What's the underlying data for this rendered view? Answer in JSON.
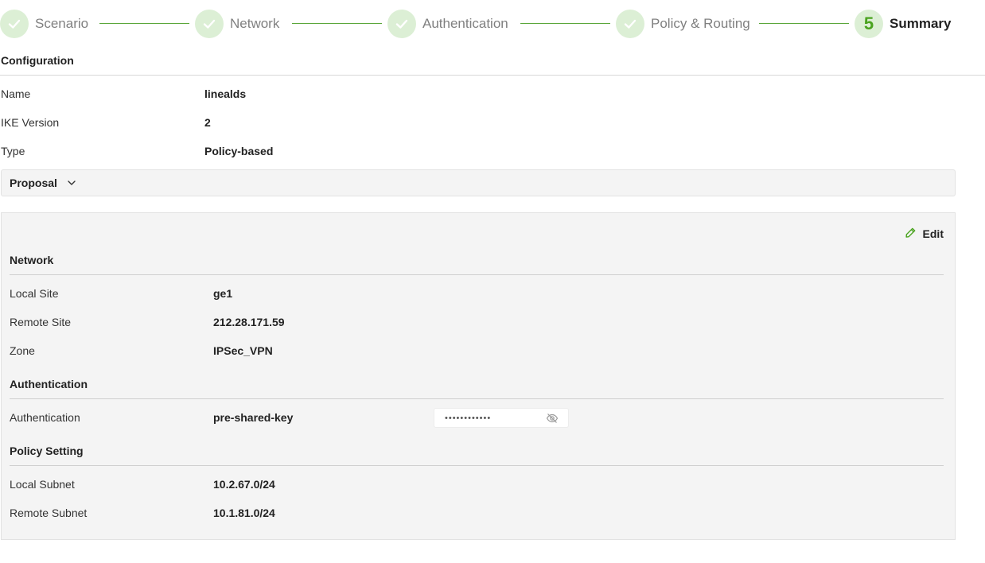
{
  "stepper": {
    "steps": [
      {
        "label": "Scenario",
        "state": "done"
      },
      {
        "label": "Network",
        "state": "done"
      },
      {
        "label": "Authentication",
        "state": "done"
      },
      {
        "label": "Policy & Routing",
        "state": "done"
      },
      {
        "label": "Summary",
        "state": "active",
        "number": "5"
      }
    ]
  },
  "configuration": {
    "title": "Configuration",
    "rows": [
      {
        "label": "Name",
        "value": "linealds"
      },
      {
        "label": "IKE Version",
        "value": "2"
      },
      {
        "label": "Type",
        "value": "Policy-based"
      }
    ],
    "proposal_label": "Proposal"
  },
  "panel": {
    "edit_label": "Edit",
    "network": {
      "title": "Network",
      "rows": [
        {
          "label": "Local Site",
          "value": "ge1"
        },
        {
          "label": "Remote Site",
          "value": "212.28.171.59"
        },
        {
          "label": "Zone",
          "value": "IPSec_VPN"
        }
      ]
    },
    "authentication": {
      "title": "Authentication",
      "rows": [
        {
          "label": "Authentication",
          "value": "pre-shared-key"
        }
      ],
      "psk_masked": "••••••••••••"
    },
    "policy": {
      "title": "Policy Setting",
      "rows": [
        {
          "label": "Local Subnet",
          "value": "10.2.67.0/24"
        },
        {
          "label": "Remote Subnet",
          "value": "10.1.81.0/24"
        }
      ]
    }
  },
  "colors": {
    "accent_green": "#4aa31f",
    "step_circle_bg": "#dcefd5",
    "panel_bg": "#f4f4f4"
  },
  "icons": {
    "step_done": "check-icon",
    "proposal": "chevron-down-icon",
    "edit": "pencil-icon",
    "psk_toggle": "eye-off-icon"
  }
}
